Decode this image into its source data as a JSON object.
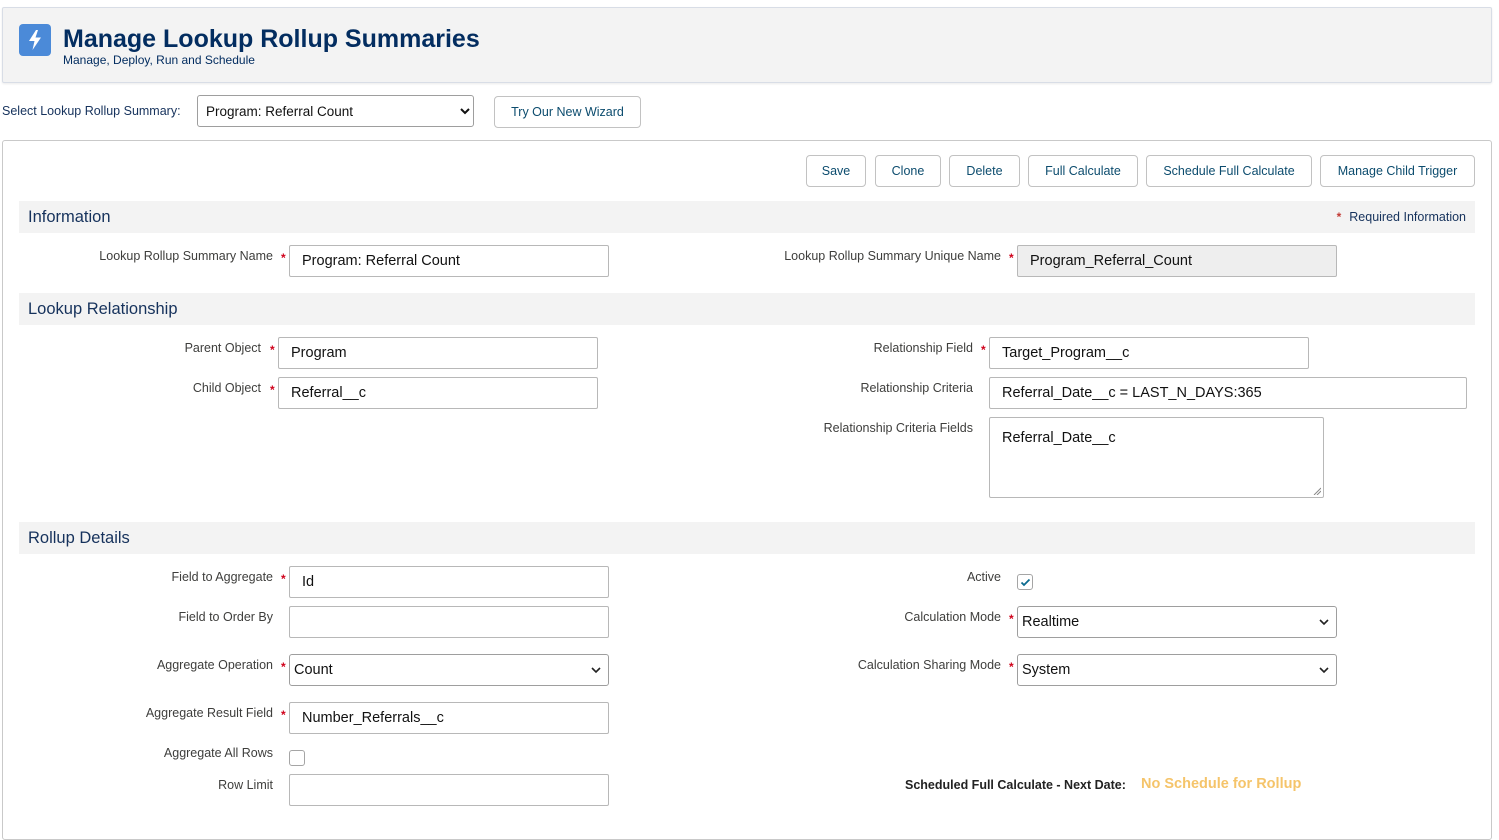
{
  "header": {
    "title": "Manage Lookup Rollup Summaries",
    "subtitle": "Manage, Deploy, Run and Schedule",
    "logo_icon": "lightning-bolt-icon",
    "brand_color": "#4b8ad8"
  },
  "selector": {
    "label": "Select Lookup Rollup Summary:",
    "value": "Program: Referral Count",
    "wizard_button": "Try Our New Wizard"
  },
  "toolbar": {
    "save": "Save",
    "clone": "Clone",
    "delete": "Delete",
    "full_calculate": "Full Calculate",
    "schedule_full_calculate": "Schedule Full Calculate",
    "manage_child_trigger": "Manage Child Trigger"
  },
  "information": {
    "title": "Information",
    "required_info": "Required Information",
    "name_label": "Lookup Rollup Summary Name",
    "name_value": "Program: Referral Count",
    "unique_name_label": "Lookup Rollup Summary Unique Name",
    "unique_name_value": "Program_Referral_Count"
  },
  "lookup_relationship": {
    "title": "Lookup Relationship",
    "parent_object_label": "Parent Object",
    "parent_object_value": "Program",
    "child_object_label": "Child Object",
    "child_object_value": "Referral__c",
    "relationship_field_label": "Relationship Field",
    "relationship_field_value": "Target_Program__c",
    "relationship_criteria_label": "Relationship Criteria",
    "relationship_criteria_value": "Referral_Date__c = LAST_N_DAYS:365",
    "relationship_criteria_fields_label": "Relationship Criteria Fields",
    "relationship_criteria_fields_value": "Referral_Date__c"
  },
  "rollup_details": {
    "title": "Rollup Details",
    "field_to_aggregate_label": "Field to Aggregate",
    "field_to_aggregate_value": "Id",
    "field_to_order_by_label": "Field to Order By",
    "field_to_order_by_value": "",
    "aggregate_operation_label": "Aggregate Operation",
    "aggregate_operation_value": "Count",
    "aggregate_result_field_label": "Aggregate Result Field",
    "aggregate_result_field_value": "Number_Referrals__c",
    "aggregate_all_rows_label": "Aggregate All Rows",
    "aggregate_all_rows_checked": false,
    "row_limit_label": "Row Limit",
    "row_limit_value": "",
    "active_label": "Active",
    "active_checked": true,
    "calculation_mode_label": "Calculation Mode",
    "calculation_mode_value": "Realtime",
    "calculation_sharing_mode_label": "Calculation Sharing Mode",
    "calculation_sharing_mode_value": "System",
    "scheduled_label": "Scheduled Full Calculate - Next Date:",
    "scheduled_value": "No Schedule for Rollup",
    "scheduled_value_color": "#f5c46a"
  },
  "colors": {
    "required_star": "#d0021b",
    "section_bg": "#f3f3f3",
    "heading": "#032d60"
  }
}
